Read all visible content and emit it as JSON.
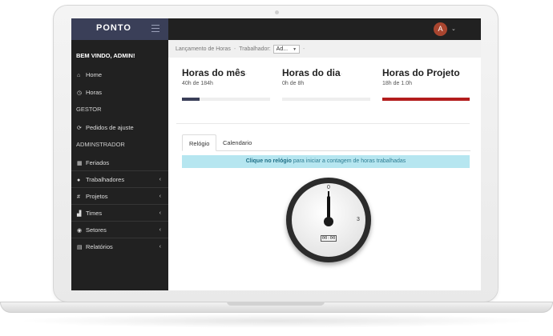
{
  "brand": {
    "logo_text": "PONTO"
  },
  "user": {
    "avatar_initial": "A"
  },
  "sidebar": {
    "welcome": "BEM VINDO, ADMIN!",
    "items": [
      {
        "label": "Home",
        "icon": "home-icon",
        "glyph": "⌂"
      },
      {
        "label": "Horas",
        "icon": "clock-icon",
        "glyph": "◷"
      },
      {
        "section": "GESTOR"
      },
      {
        "label": "Pedidos de ajuste",
        "icon": "refresh-icon",
        "glyph": "⟳"
      },
      {
        "section": "ADMINSTRADOR"
      },
      {
        "label": "Feriados",
        "icon": "calendar-icon",
        "glyph": "▦"
      },
      {
        "label": "Trabalhadores",
        "icon": "user-icon",
        "glyph": "●",
        "arrow": "‹"
      },
      {
        "label": "Projetos",
        "icon": "hash-icon",
        "glyph": "#",
        "arrow": "‹"
      },
      {
        "label": "Times",
        "icon": "sitemap-icon",
        "glyph": "▟",
        "arrow": "‹"
      },
      {
        "label": "Setores",
        "icon": "users-icon",
        "glyph": "◉",
        "arrow": "‹"
      },
      {
        "label": "Relatórios",
        "icon": "file-icon",
        "glyph": "▤",
        "arrow": "‹"
      }
    ]
  },
  "breadcrumb": {
    "page": "Lançamento de Horas",
    "separator": "-",
    "worker_label": "Trabalhador:",
    "worker_value": "Ad...",
    "trailing": "-"
  },
  "stats": [
    {
      "title": "Horas do mês",
      "subtitle": "40h de 184h",
      "progress": 0.2,
      "color": "#3a3f58"
    },
    {
      "title": "Horas do dia",
      "subtitle": "0h de 8h",
      "progress": 0.0,
      "color": "#3a3f58"
    },
    {
      "title": "Horas do Projeto",
      "subtitle": "18h de 1.0h",
      "progress": 1.0,
      "color": "#b31d1d"
    }
  ],
  "tabs": {
    "clock": "Relógio",
    "calendar": "Calendario"
  },
  "alert": {
    "bold": "Clique no relógio",
    "rest": " para iniciar a contagem de horas trabalhadas"
  },
  "clock": {
    "top_number": "0",
    "right_number": "3",
    "digital": "00:00"
  },
  "colors": {
    "sidebar_bg": "#212121",
    "brand_bg": "#3a3f58",
    "alert_bg": "#b6e6f0",
    "accent_red": "#b31d1d"
  }
}
